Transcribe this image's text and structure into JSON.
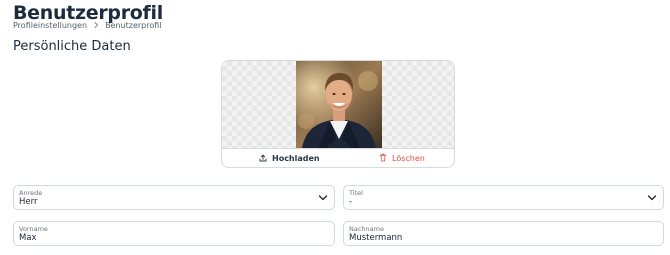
{
  "header": {
    "title": "Benutzerprofil",
    "breadcrumb": [
      "Profileinstellungen",
      "Benutzerprofil"
    ]
  },
  "section": {
    "title": "Persönliche Daten"
  },
  "photo": {
    "upload_label": "Hochladen",
    "delete_label": "Löschen",
    "delete_color": "#e34b4b"
  },
  "form": {
    "salutation": {
      "label": "Anrede",
      "value": "Herr"
    },
    "title": {
      "label": "Titel",
      "value": "-"
    },
    "first_name": {
      "label": "Vorname",
      "value": "Max"
    },
    "last_name": {
      "label": "Nachname",
      "value": "Mustermann"
    }
  },
  "icons": {
    "breadcrumb_separator": "chevron-right-icon",
    "upload": "upload-icon",
    "delete": "trash-icon",
    "dropdown": "chevron-down-icon"
  }
}
